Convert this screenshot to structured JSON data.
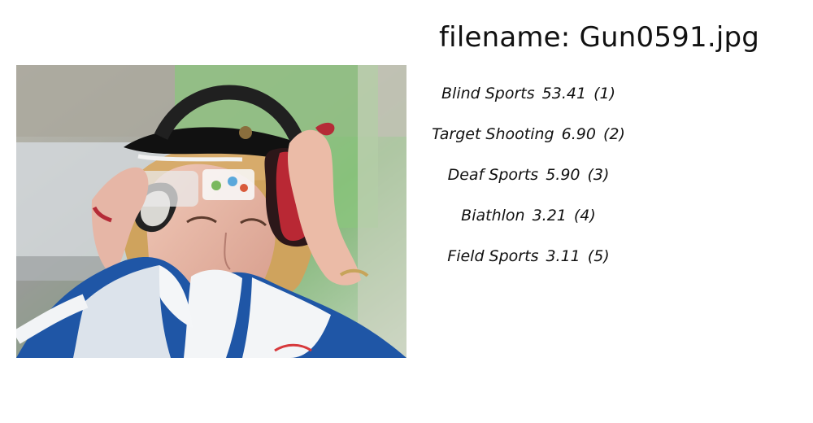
{
  "image": {
    "subject": "woman-sport-shooter-with-ear-protectors-and-visor",
    "colors": {
      "background_green": "#8fc07a",
      "shirt_blue": "#1f56a6",
      "visor": "#111111",
      "earmuff_red": "#b92834"
    }
  },
  "header": {
    "filename_text": "filename: Gun0591.jpg"
  },
  "predictions": [
    {
      "label": "Blind Sports",
      "score": "53.41",
      "rank": "(1)"
    },
    {
      "label": "Target Shooting",
      "score": "6.90",
      "rank": "(2)"
    },
    {
      "label": "Deaf Sports",
      "score": "5.90",
      "rank": "(3)"
    },
    {
      "label": "Biathlon",
      "score": "3.21",
      "rank": "(4)"
    },
    {
      "label": "Field Sports",
      "score": "3.11",
      "rank": "(5)"
    }
  ]
}
